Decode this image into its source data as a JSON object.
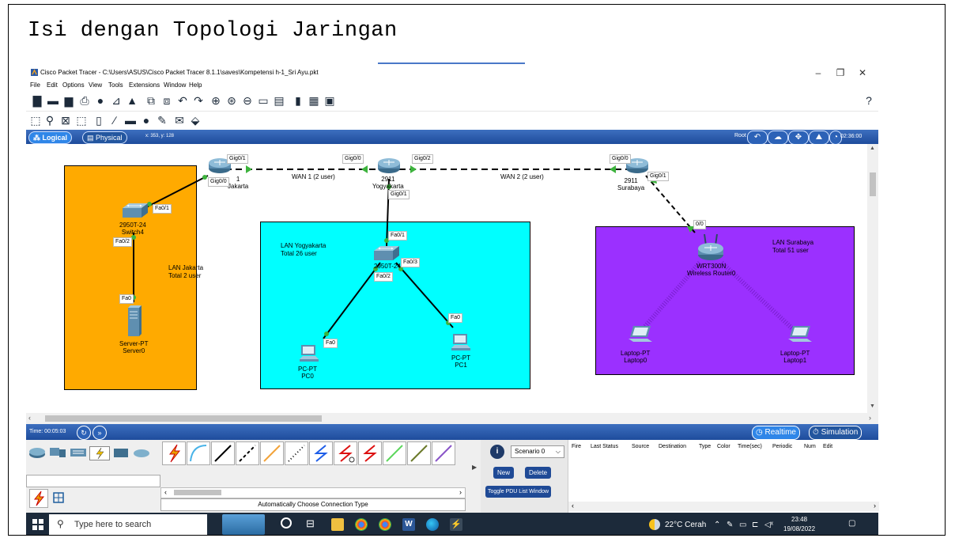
{
  "document": {
    "heading": "Isi dengan Topologi Jaringan"
  },
  "window": {
    "title": "Cisco Packet Tracer - C:\\Users\\ASUS\\Cisco Packet Tracer 8.1.1\\saves\\Kompetensi h-1_Sri Ayu.pkt",
    "controls": {
      "minimize": "–",
      "restore": "❐",
      "close": "✕"
    }
  },
  "menu": [
    "File",
    "Edit",
    "Options",
    "View",
    "Tools",
    "Extensions",
    "Window",
    "Help"
  ],
  "help_icon": "?",
  "modebar": {
    "logical": "Logical",
    "physical": "Physical",
    "coords": "x: 353, y: 128",
    "root": "Root",
    "clock": "02:36:00"
  },
  "topology": {
    "lans": [
      {
        "name": "LAN Jakarta",
        "desc": "Total 2 user",
        "color": "#ffaa00"
      },
      {
        "name": "LAN Yogyakarta",
        "desc": "Total 26 user",
        "color": "#00ffff"
      },
      {
        "name": "LAN Surabaya",
        "desc": "Total 51 user",
        "color": "#9b30ff"
      }
    ],
    "devices": {
      "router_jkt": {
        "model": "1",
        "name": "Jakarta"
      },
      "router_yog": {
        "model": "2911",
        "name": "Yogyakarta"
      },
      "router_sby": {
        "model": "2911",
        "name": "Surabaya"
      },
      "switch_jkt": {
        "model": "2950T-24",
        "name": "Switch4"
      },
      "switch_yog": {
        "model": "2950T-24",
        "name": ""
      },
      "server": {
        "model": "Server-PT",
        "name": "Server0"
      },
      "pc0": {
        "model": "PC-PT",
        "name": "PC0"
      },
      "pc1": {
        "model": "PC-PT",
        "name": "PC1"
      },
      "wrouter": {
        "model": "WRT300N",
        "name": "Wireless Router0"
      },
      "laptop0": {
        "model": "Laptop-PT",
        "name": "Laptop0"
      },
      "laptop1": {
        "model": "Laptop-PT",
        "name": "Laptop1"
      }
    },
    "links": {
      "wan1": "WAN 1 (2 user)",
      "wan2": "WAN 2 (2 user)"
    },
    "ports": {
      "jkt_gig01": "Gig0/1",
      "jkt_gig00": "Gig0/0",
      "yog_gig00": "Gig0/0",
      "yog_gig02": "Gig0/2",
      "yog_gig01": "Gig0/1",
      "sby_gig00": "Gig0/0",
      "sby_gig01": "Gig0/1",
      "sw4_fa01": "Fa0/1",
      "sw4_fa02": "Fa0/2",
      "srv_fa0": "Fa0",
      "swy_fa01": "Fa0/1",
      "swy_fa03": "Fa0/3",
      "swy_fa02": "Fa0/2",
      "pc0_fa0": "Fa0",
      "pc1_fa0": "Fa0",
      "wr_00": "0/0"
    }
  },
  "simbar": {
    "time": "Time: 00:05:03",
    "realtime": "Realtime",
    "simulation": "Simulation"
  },
  "bottom": {
    "connection_label": "Automatically Choose Connection Type",
    "scenario": "Scenario 0",
    "new": "New",
    "delete": "Delete",
    "toggle": "Toggle PDU List Window",
    "pdu_columns": [
      "Fire",
      "Last Status",
      "Source",
      "Destination",
      "Type",
      "Color",
      "Time(sec)",
      "Periodic",
      "Num",
      "Edit"
    ]
  },
  "taskbar": {
    "search_placeholder": "Type here to search",
    "weather": "22°C Cerah",
    "time": "23:48",
    "date": "19/08/2022"
  }
}
